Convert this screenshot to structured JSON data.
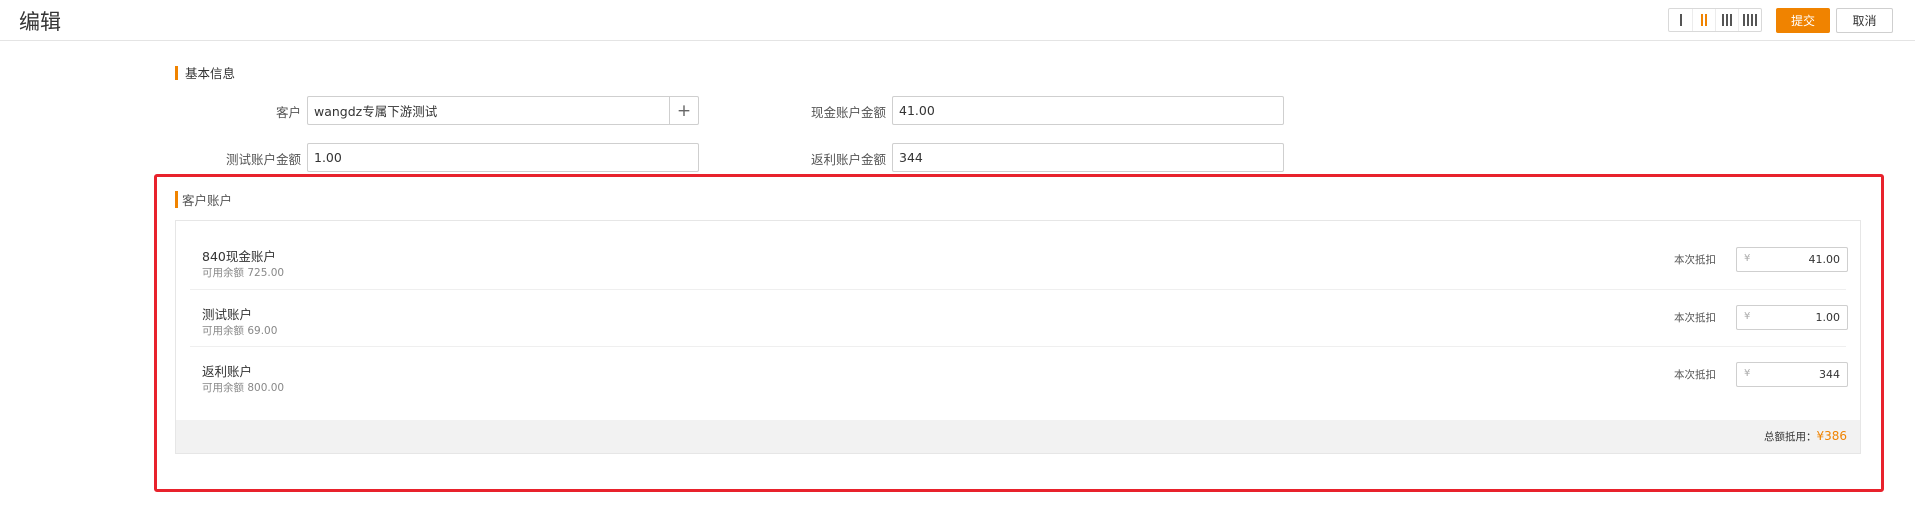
{
  "page": {
    "title": "编辑"
  },
  "toolbar": {
    "column_options": [
      "1-column-layout",
      "2-column-layout",
      "3-column-layout",
      "4-column-layout"
    ],
    "active_column": 2,
    "submit_label": "提交",
    "cancel_label": "取消"
  },
  "basic_info": {
    "heading": "基本信息",
    "customer": {
      "label": "客户",
      "value": "wangdz专属下游测试",
      "add_icon": "plus-icon"
    },
    "cash_amount": {
      "label": "现金账户金额",
      "value": "41.00"
    },
    "test_amount": {
      "label": "测试账户金额",
      "value": "1.00"
    },
    "rebate_amount": {
      "label": "返利账户金额",
      "value": "344"
    }
  },
  "customer_accounts": {
    "heading": "客户账户",
    "deduct_label": "本次抵扣",
    "currency_symbol": "¥",
    "accounts": [
      {
        "name": "840现金账户",
        "available": "可用余额 725.00",
        "deduct": "41.00"
      },
      {
        "name": "测试账户",
        "available": "可用余额 69.00",
        "deduct": "1.00"
      },
      {
        "name": "返利账户",
        "available": "可用余额 800.00",
        "deduct": "344"
      }
    ],
    "total_label": "总额抵用：",
    "total_value": "¥386"
  },
  "colors": {
    "accent": "#f08300",
    "highlight_border": "#e8222c"
  }
}
